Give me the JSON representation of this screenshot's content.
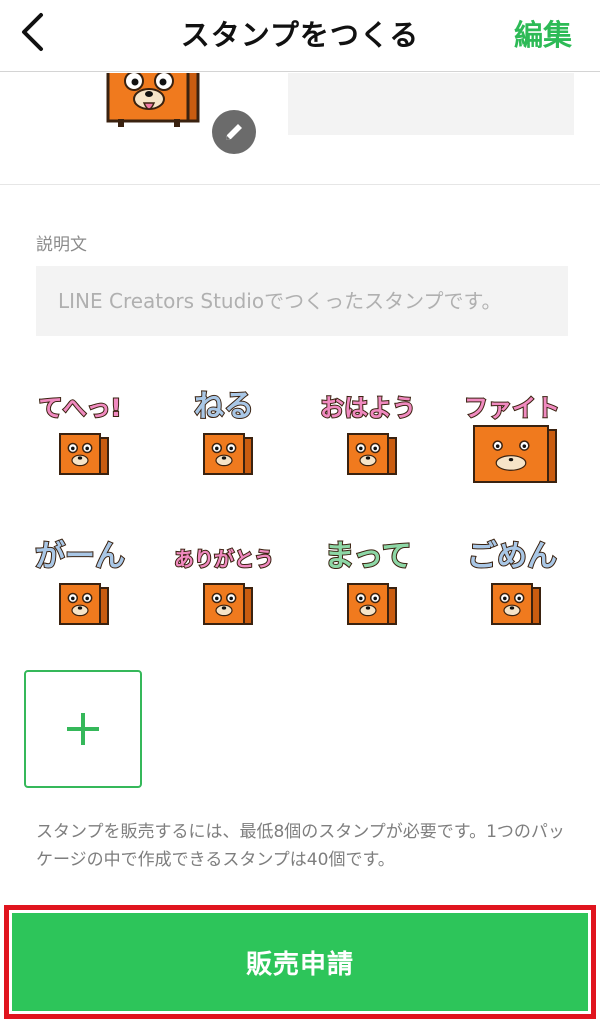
{
  "header": {
    "title": "スタンプをつくる",
    "edit_label": "編集",
    "back_icon": "chevron-left-icon"
  },
  "description": {
    "label": "説明文",
    "placeholder": "LINE Creators Studioでつくったスタンプです。"
  },
  "stickers": [
    {
      "text": "てへっ!",
      "bubble_color": "#f08ac0"
    },
    {
      "text": "ねる",
      "bubble_color": "#a9c7e6"
    },
    {
      "text": "おはよう",
      "bubble_color": "#f08ac0"
    },
    {
      "text": "ファイト",
      "bubble_color": "#f08ac0"
    },
    {
      "text": "がーん",
      "bubble_color": "#a9c7e6"
    },
    {
      "text": "ありがとう",
      "bubble_color": "#f08ac0"
    },
    {
      "text": "まって",
      "bubble_color": "#8dd7a6"
    },
    {
      "text": "ごめん",
      "bubble_color": "#a9c7e6"
    }
  ],
  "info_text": "スタンプを販売するには、最低8個のスタンプが必要です。1つのパッケージの中で作成できるスタンプは40個です。",
  "sell_button_label": "販売申請",
  "colors": {
    "accent": "#2dba56",
    "sell_button": "#2dc55a",
    "highlight_border": "#e0141e",
    "box_orange": "#f07a1e"
  }
}
